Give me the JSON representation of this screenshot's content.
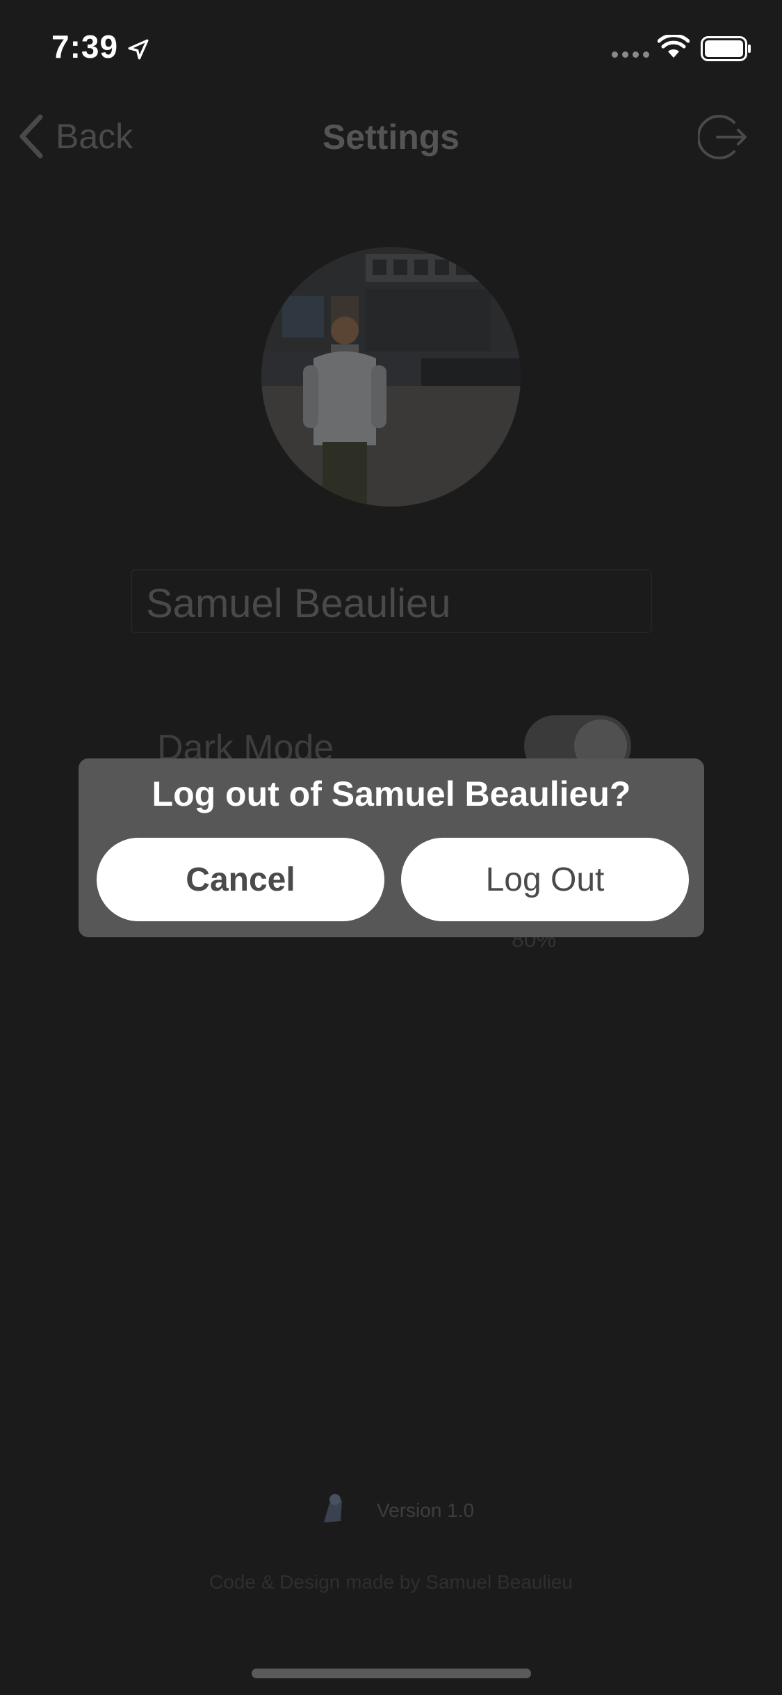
{
  "status_bar": {
    "time": "7:39"
  },
  "nav": {
    "back_label": "Back",
    "title": "Settings"
  },
  "profile": {
    "name": "Samuel Beaulieu"
  },
  "settings": {
    "dark_mode_label": "Dark Mode",
    "dark_mode_on": true,
    "percent_label": "80%"
  },
  "alert": {
    "title": "Log out of Samuel Beaulieu?",
    "cancel_label": "Cancel",
    "confirm_label": "Log Out"
  },
  "footer": {
    "version": "Version 1.0",
    "credit": "Code & Design made by Samuel Beaulieu"
  },
  "colors": {
    "background": "#1b1b1b",
    "alert_background": "#575757",
    "button_background": "#ffffff"
  },
  "icons": [
    "location-arrow-icon",
    "wifi-icon",
    "battery-icon",
    "chevron-left-icon",
    "logout-icon",
    "app-logo-icon"
  ]
}
